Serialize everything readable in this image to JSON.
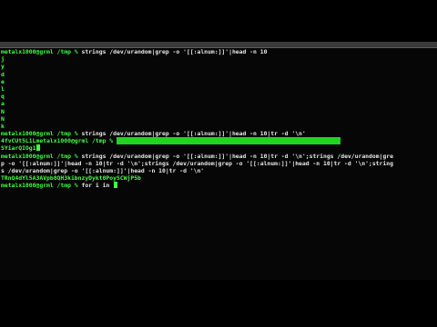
{
  "prompt": "metalx1000@grml /tmp %",
  "commands": {
    "c1": "strings /dev/urandom|grep -o '[[:alnum:]]'|head -n 10",
    "c2": "strings /dev/urandom|grep -o '[[:alnum:]]'|head -n 10|tr -d '\\n'",
    "c4a": "strings /dev/urandom|grep -o '[[:alnum:]]'|head -n 10|tr -d '\\n';strings /dev/urandom|gre",
    "c4b": "p -o '[[:alnum:]]'|head -n 10|tr -d '\\n';strings /dev/urandom|grep -o '[[:alnum:]]'|head -n 10|tr -d '\\n';string",
    "c4c": "s /dev/urandom|grep -o '[[:alnum:]]'|head -n 10|tr -d '\\n'",
    "c5": "for i in "
  },
  "outputs": {
    "chars": [
      "j",
      "y",
      "d",
      "e",
      "l",
      "q",
      "a",
      "N",
      "N",
      "k"
    ],
    "o2": "4fvCUt5L1L",
    "o3": "SYiarQIOg1",
    "o4": "TRnQ4dYl5A3AVpb8QH3kibnzyDykt0PoySCWjP5b"
  }
}
